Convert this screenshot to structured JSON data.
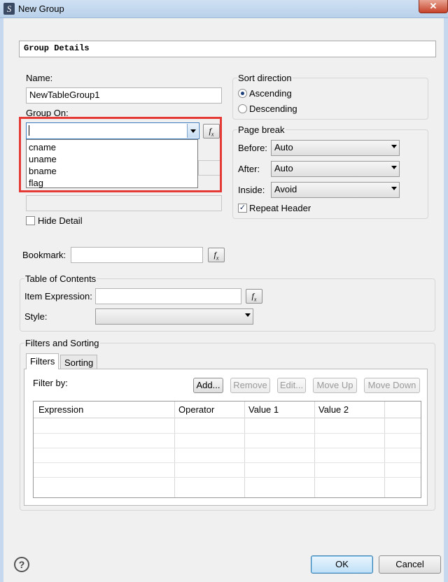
{
  "window": {
    "title": "New Group",
    "app_icon_glyph": "S"
  },
  "header": {
    "section_title": "Group Details"
  },
  "group_details": {
    "name_label": "Name:",
    "name_value": "NewTableGroup1",
    "group_on_label": "Group On:",
    "group_on_value": "",
    "group_on_options": [
      "cname",
      "uname",
      "bname",
      "flag"
    ],
    "hide_detail_label": "Hide Detail",
    "hide_detail_checked": false
  },
  "sort_direction": {
    "title": "Sort direction",
    "options": [
      {
        "label": "Ascending",
        "selected": true
      },
      {
        "label": "Descending",
        "selected": false
      }
    ]
  },
  "page_break": {
    "title": "Page break",
    "before_label": "Before:",
    "before_value": "Auto",
    "after_label": "After:",
    "after_value": "Auto",
    "inside_label": "Inside:",
    "inside_value": "Avoid",
    "repeat_header_label": "Repeat Header",
    "repeat_header_checked": true
  },
  "bookmark": {
    "label": "Bookmark:",
    "value": ""
  },
  "toc": {
    "title": "Table of Contents",
    "item_expression_label": "Item Expression:",
    "item_expression_value": "",
    "style_label": "Style:",
    "style_value": ""
  },
  "filters_sorting": {
    "title": "Filters and Sorting",
    "tabs": [
      "Filters",
      "Sorting"
    ],
    "active_tab": "Filters",
    "filter_by_label": "Filter by:",
    "buttons": {
      "add": "Add...",
      "remove": "Remove",
      "edit": "Edit...",
      "move_up": "Move Up",
      "move_down": "Move Down"
    },
    "columns": [
      "Expression",
      "Operator",
      "Value 1",
      "Value 2"
    ]
  },
  "footer": {
    "ok_label": "OK",
    "cancel_label": "Cancel",
    "help_glyph": "?"
  },
  "colors": {
    "highlight_box": "#e53935",
    "titlebar": "#c5d8ee",
    "close_button": "#c7432a",
    "ok_button_border": "#3c7fb1"
  },
  "icons": [
    "app-icon",
    "close-icon",
    "fx-icon",
    "chevron-down-icon",
    "help-icon"
  ]
}
